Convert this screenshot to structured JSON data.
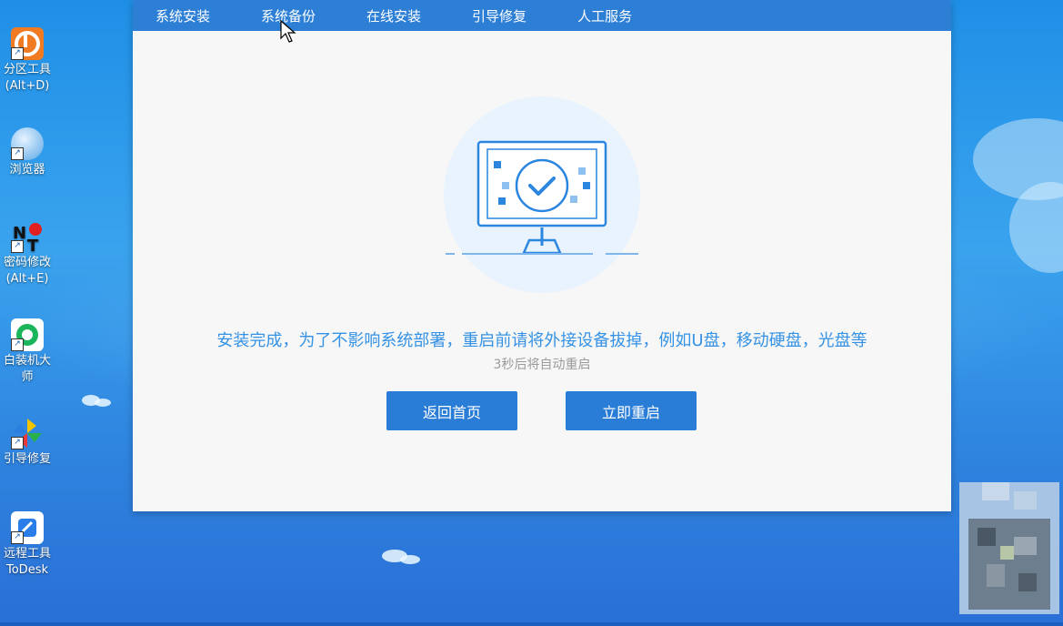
{
  "desktop": {
    "icons": [
      {
        "name": "partition-tool",
        "label": "分区工具",
        "sub": "(Alt+D)"
      },
      {
        "name": "browser",
        "label": "浏览器",
        "sub": ""
      },
      {
        "name": "password-change",
        "label": "密码修改",
        "sub": "(Alt+E)"
      },
      {
        "name": "install-master",
        "label": "白装机大师",
        "sub": ""
      },
      {
        "name": "boot-repair",
        "label": "引导修复",
        "sub": ""
      },
      {
        "name": "todesk",
        "label": "远程工具",
        "sub": "ToDesk"
      }
    ]
  },
  "window": {
    "tabs": [
      "系统安装",
      "系统备份",
      "在线安装",
      "引导修复",
      "人工服务"
    ],
    "message": "安装完成，为了不影响系统部署，重启前请将外接设备拔掉，例如U盘，移动硬盘，光盘等",
    "countdown": "3秒后将自动重启",
    "buttons": {
      "back_home": "返回首页",
      "restart_now": "立即重启"
    }
  },
  "colors": {
    "accent": "#2d7fd6",
    "message": "#3592e4",
    "countdown": "#9a9a9a",
    "window_bg": "#f7f7f7"
  }
}
